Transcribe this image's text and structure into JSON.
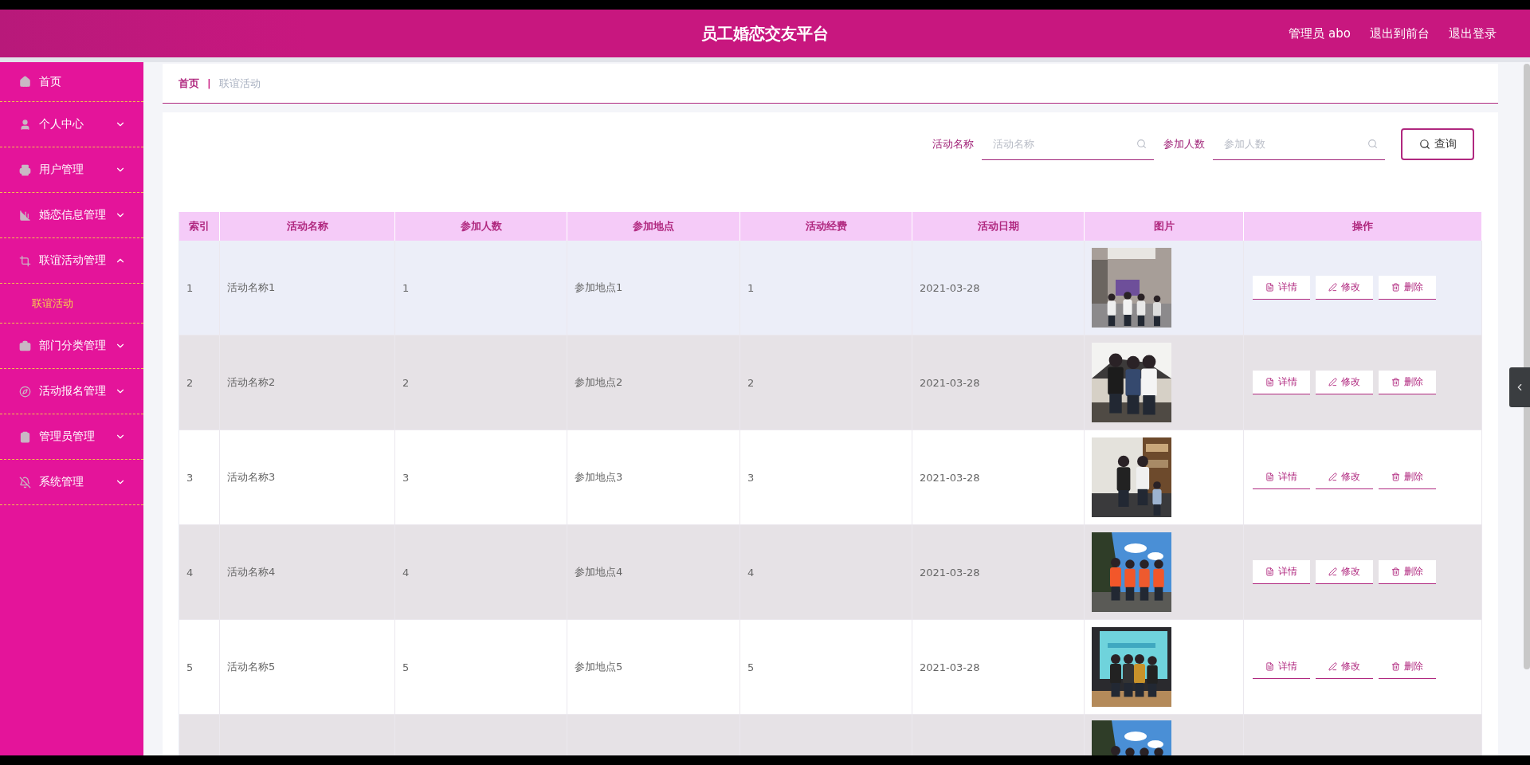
{
  "header": {
    "title": "员工婚恋交友平台",
    "links": [
      "管理员 abo",
      "退出到前台",
      "退出登录"
    ]
  },
  "sidebar": {
    "items": [
      {
        "label": "首页"
      },
      {
        "label": "个人中心",
        "expanded": false
      },
      {
        "label": "用户管理",
        "expanded": false
      },
      {
        "label": "婚恋信息管理",
        "expanded": false
      },
      {
        "label": "联谊活动管理",
        "expanded": true,
        "children": [
          {
            "label": "联谊活动",
            "selected": true
          }
        ]
      },
      {
        "label": "部门分类管理",
        "expanded": false
      },
      {
        "label": "活动报名管理",
        "expanded": false
      },
      {
        "label": "管理员管理",
        "expanded": false
      },
      {
        "label": "系统管理",
        "expanded": false
      }
    ]
  },
  "breadcrumb": {
    "items": [
      "首页",
      "联谊活动"
    ],
    "separator": "|"
  },
  "search": {
    "fields": [
      {
        "label": "活动名称",
        "placeholder": "活动名称"
      },
      {
        "label": "参加人数",
        "placeholder": "参加人数"
      }
    ],
    "button": "查询"
  },
  "table": {
    "columns": [
      "索引",
      "活动名称",
      "参加人数",
      "参加地点",
      "活动经费",
      "活动日期",
      "图片",
      "操作"
    ],
    "rows": [
      {
        "cells": [
          "1",
          "活动名称1",
          "1",
          "参加地点1",
          "1",
          "2021-03-28"
        ],
        "hovered": true,
        "actions": [
          "详情",
          "修改",
          "删除"
        ]
      },
      {
        "cells": [
          "2",
          "活动名称2",
          "2",
          "参加地点2",
          "2",
          "2021-03-28"
        ],
        "hovered": false,
        "actions": [
          "详情",
          "修改",
          "删除"
        ]
      },
      {
        "cells": [
          "3",
          "活动名称3",
          "3",
          "参加地点3",
          "3",
          "2021-03-28"
        ],
        "hovered": false,
        "actions": [
          "详情",
          "修改",
          "删除"
        ]
      },
      {
        "cells": [
          "4",
          "活动名称4",
          "4",
          "参加地点4",
          "4",
          "2021-03-28"
        ],
        "hovered": false,
        "actions": [
          "详情",
          "修改",
          "删除"
        ]
      },
      {
        "cells": [
          "5",
          "活动名称5",
          "5",
          "参加地点5",
          "5",
          "2021-03-28"
        ],
        "hovered": false,
        "actions": [
          "详情",
          "修改",
          "删除"
        ]
      }
    ]
  }
}
